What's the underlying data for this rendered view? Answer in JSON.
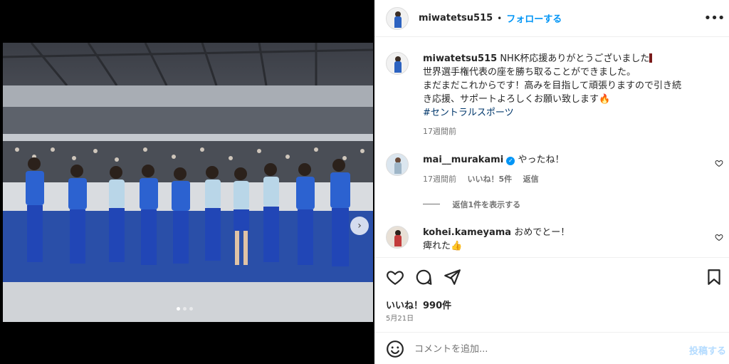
{
  "header": {
    "username": "miwatetsu515",
    "separator": "•",
    "follow_label": "フォローする",
    "more_icon": "more-horizontal-icon"
  },
  "caption": {
    "username": "miwatetsu515",
    "lines": [
      "NHK杯応援ありがとうございました",
      "世界選手権代表の座を勝ち取ることができました。",
      "まだまだこれからです！高みを目指して頑張りますので引き続",
      "き応援、サポートよろしくお願い致します"
    ],
    "hashtag": "#セントラルスポーツ",
    "time": "17週間前"
  },
  "comments": [
    {
      "username": "mai__murakami",
      "verified": true,
      "text": "やったね！",
      "time": "17週間前",
      "likes": "いいね！5件",
      "reply_label": "返信",
      "view_replies": "返信1件を表示する"
    },
    {
      "username": "kohei.kameyama",
      "text_line1": "おめでとー！",
      "text_line2": "痺れた"
    }
  ],
  "actions": {
    "like_icon": "heart-icon",
    "comment_icon": "comment-icon",
    "share_icon": "share-icon",
    "save_icon": "bookmark-icon"
  },
  "likes_count": "いいね！990件",
  "post_date": "5月21日",
  "composer": {
    "placeholder": "コメントを追加...",
    "post_label": "投稿する",
    "emoji_icon": "smile-icon"
  },
  "colors": {
    "accent": "#0095f6",
    "post_disabled": "#b3dbff",
    "hashtag": "#00376b",
    "verified": "#0095f6"
  },
  "carousel": {
    "current": 1,
    "total": 3
  }
}
